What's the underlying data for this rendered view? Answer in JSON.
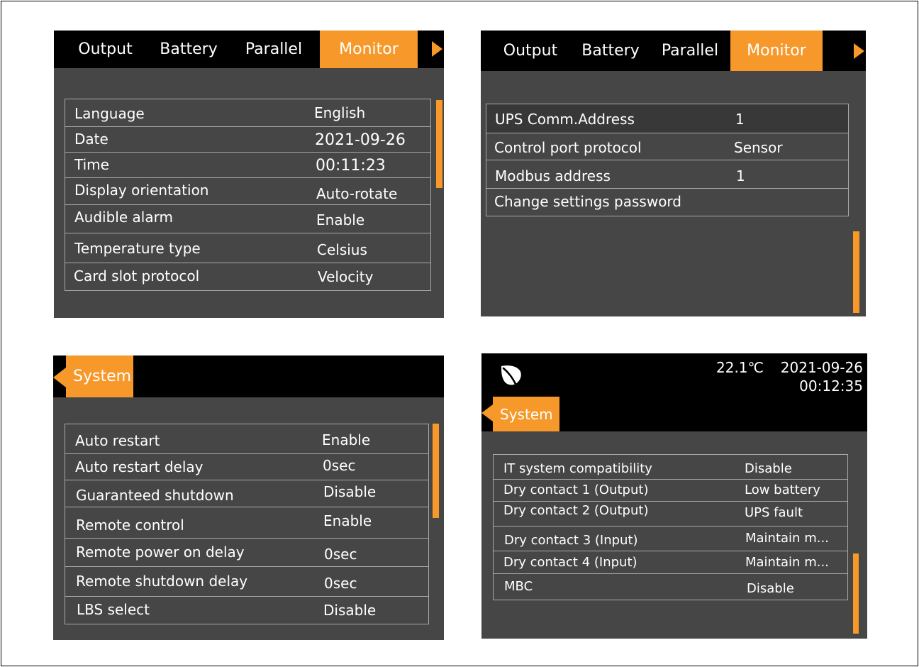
{
  "colors": {
    "accent": "#f7982a",
    "panel_bg": "#464646",
    "bar_bg": "#000000",
    "text": "#ffffff",
    "divider": "#a8a8a8"
  },
  "screen1": {
    "tabs": [
      "Output",
      "Battery",
      "Parallel",
      "Monitor"
    ],
    "active_tab": "Monitor",
    "rows": [
      {
        "label": "Language",
        "value": "English"
      },
      {
        "label": "Date",
        "value": "2021-09-26"
      },
      {
        "label": "Time",
        "value": "00:11:23"
      },
      {
        "label": "Display orientation",
        "value": "Auto-rotate"
      },
      {
        "label": "Audible alarm",
        "value": "Enable"
      },
      {
        "label": "Temperature type",
        "value": "Celsius"
      },
      {
        "label": "Card slot protocol",
        "value": "Velocity"
      }
    ]
  },
  "screen2": {
    "tabs": [
      "Output",
      "Battery",
      "Parallel",
      "Monitor"
    ],
    "active_tab": "Monitor",
    "rows": [
      {
        "label": "UPS Comm.Address",
        "value": "1"
      },
      {
        "label": "Control port protocol",
        "value": "Sensor"
      },
      {
        "label": "Modbus address",
        "value": "1"
      },
      {
        "label": "Change settings password",
        "value": ""
      }
    ]
  },
  "screen3": {
    "tab": "System",
    "rows": [
      {
        "label": "Auto restart",
        "value": "Enable"
      },
      {
        "label": "Auto restart delay",
        "value": "0sec"
      },
      {
        "label": "Guaranteed shutdown",
        "value": "Disable"
      },
      {
        "label": "Remote control",
        "value": "Enable"
      },
      {
        "label": "Remote power on delay",
        "value": "0sec"
      },
      {
        "label": "Remote shutdown delay",
        "value": "0sec"
      },
      {
        "label": "LBS select",
        "value": "Disable"
      }
    ]
  },
  "screen4": {
    "status": {
      "temperature": "22.1℃",
      "date": "2021-09-26",
      "time": "00:12:35",
      "icon": "leaf-icon"
    },
    "tab": "System",
    "rows": [
      {
        "label": "IT system compatibility",
        "value": "Disable"
      },
      {
        "label": "Dry contact 1 (Output)",
        "value": "Low battery"
      },
      {
        "label": "Dry contact 2 (Output)",
        "value": "UPS fault"
      },
      {
        "label": "Dry contact 3 (Input)",
        "value": "Maintain m..."
      },
      {
        "label": "Dry contact 4 (Input)",
        "value": "Maintain m..."
      },
      {
        "label": "MBC",
        "value": "Disable"
      }
    ]
  }
}
